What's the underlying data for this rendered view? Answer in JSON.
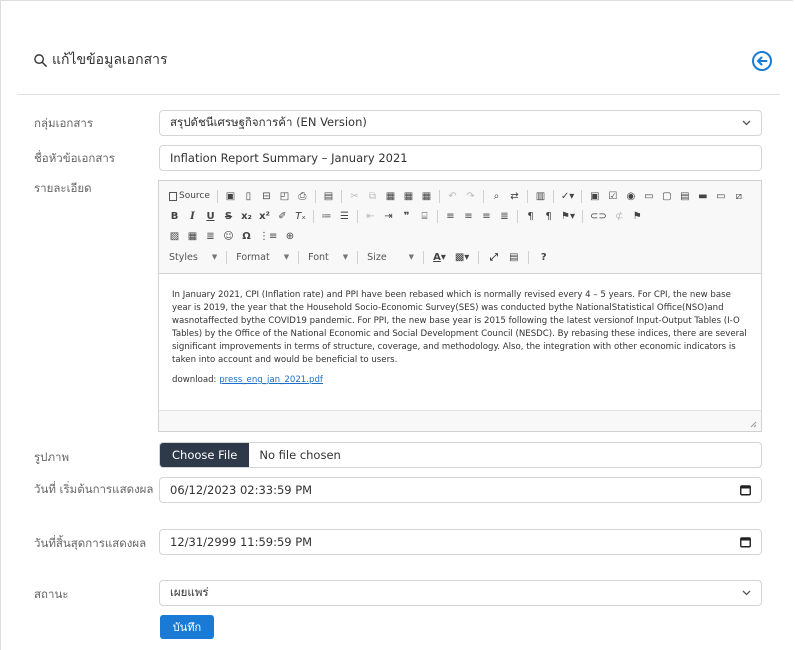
{
  "page": {
    "title": "แก้ไขข้อมูลเอกสาร",
    "save_label": "บันทึก"
  },
  "fields": {
    "group": {
      "label": "กลุ่มเอกสาร",
      "value": "สรุปดัชนีเศรษฐกิจการค้า (EN Version)"
    },
    "doc_title": {
      "label": "ชื่อหัวข้อเอกสาร",
      "value": "Inflation Report Summary – January 2021"
    },
    "detail": {
      "label": "รายละเอียด"
    },
    "image": {
      "label": "รูปภาพ",
      "button": "Choose File",
      "status": "No file chosen"
    },
    "start": {
      "label": "วันที่ เริ่มต้นการแสดงผล",
      "value": "06/12/2023 02:33:59 PM"
    },
    "end": {
      "label": "วันที่สิ้นสุดการแสดงผล",
      "value": "12/31/2999 11:59:59 PM"
    },
    "status": {
      "label": "สถานะ",
      "value": "เผยแพร่"
    }
  },
  "editor": {
    "source_label": "Source",
    "styles_label": "Styles",
    "format_label": "Format",
    "font_label": "Font",
    "size_label": "Size",
    "paragraph": "In January 2021, CPI (Inflation rate) and PPI have been rebased which is normally revised every 4 – 5 years. For CPI, the new base year is 2019, the year that the Household Socio-Economic Survey(SES) was conducted bythe NationalStatistical Office(NSO)and wasnotaffected bythe COVID19 pandemic. For PPI, the new base year is 2015 following the latest versionof Input-Output Tables (I-O Tables) by the Office of the National Economic and Social Development Council (NESDC). By rebasing these indices, there are several significant improvements in terms of structure, coverage, and methodology. Also, the integration with other economic indicators is taken into account and would be beneficial to users.",
    "download_label": "download:",
    "download_link": "press_eng_jan_2021.pdf"
  },
  "colors": {
    "accent": "#1a7bd6",
    "file_button": "#2e3a4a"
  }
}
